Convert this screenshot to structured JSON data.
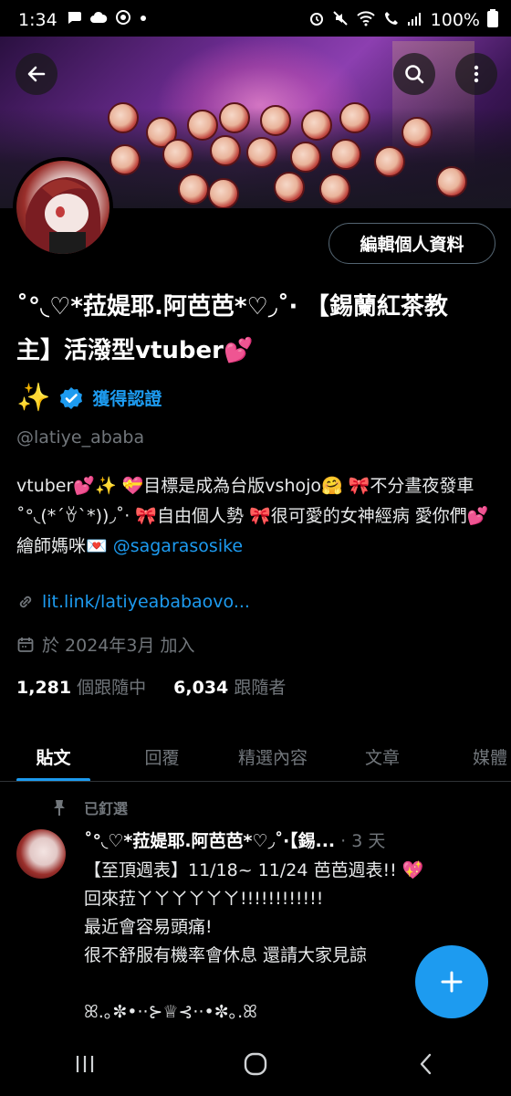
{
  "status_bar": {
    "time": "1:34",
    "battery": "100%",
    "left_icons": [
      "chat-bubble-icon",
      "cloud-icon",
      "target-icon",
      "dot-icon"
    ],
    "right_icons": [
      "alarm-icon",
      "mute-icon",
      "wifi-icon",
      "call-icon",
      "signal-icon"
    ]
  },
  "profile": {
    "edit_button": "編輯個人資料",
    "display_name": "˚°◟♡*菈媞耶.阿芭芭*♡◞˚‧ 【錫蘭紅茶教主】活潑型vtuber💕",
    "sparkle": "✨",
    "verified_label": "獲得認證",
    "handle": "@latiye_ababa",
    "bio_text": "vtuber💕✨ 💝目標是成為台版vshojo🤗 🎀不分晝夜發車˚°◟(*´ꈊ`*))◞˚‧ 🎀自由個人勢 🎀很可愛的女神經病 愛你們💕 繪師媽咪💌 ",
    "bio_mention": "@sagarasosike",
    "link": "lit.link/latiyeababaovo...",
    "joined": "於 2024年3月 加入",
    "following_count": "1,281",
    "following_label": "個跟隨中",
    "followers_count": "6,034",
    "followers_label": "跟隨者"
  },
  "tabs": [
    {
      "label": "貼文",
      "active": true
    },
    {
      "label": "回覆",
      "active": false
    },
    {
      "label": "精選內容",
      "active": false
    },
    {
      "label": "文章",
      "active": false
    },
    {
      "label": "媒體",
      "active": false
    }
  ],
  "pinned_post": {
    "pinned_label": "已釘選",
    "author": "˚°◟♡*菈媞耶.阿芭芭*♡◞˚‧【錫...",
    "time": " · 3 天",
    "body": "【至頂週表】11/18~ 11/24 芭芭週表!! 💖\n回來菈ㄚㄚㄚㄚㄚㄚ!!!!!!!!!!!!\n最近會容易頭痛!\n很不舒服有機率會休息 還請大家見諒\n\nꕤ.｡✼•··⊱♕⊰··•✼｡.ꕤ"
  },
  "colors": {
    "accent": "#1d9bf0",
    "background": "#000000",
    "muted_text": "#71767b"
  }
}
